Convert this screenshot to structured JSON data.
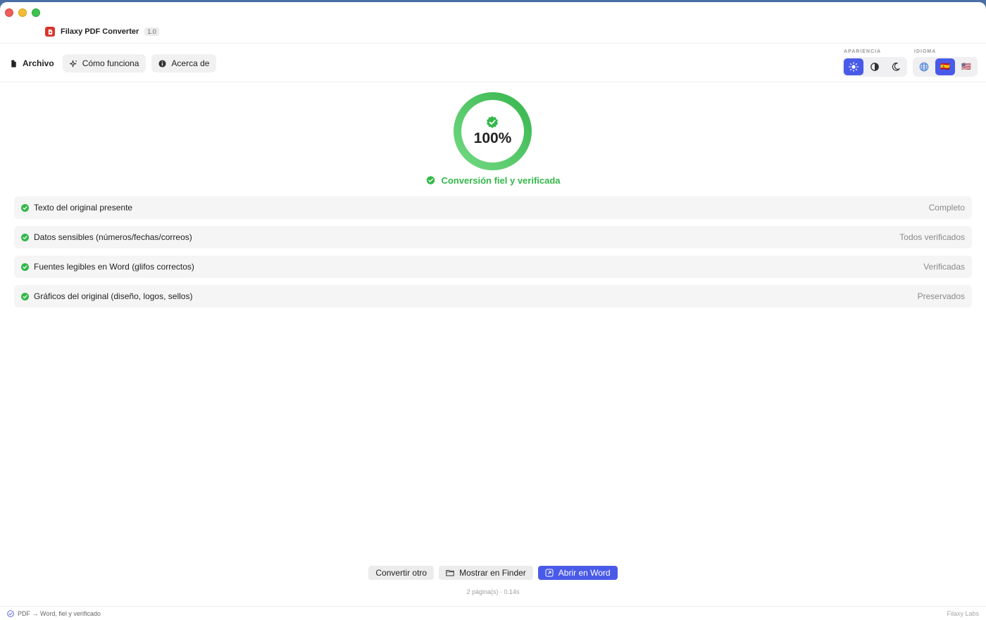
{
  "app": {
    "name": "Filaxy PDF Converter",
    "version": "1.0"
  },
  "nav": {
    "items": [
      {
        "label": "Archivo",
        "icon": "document-icon",
        "active": true
      },
      {
        "label": "Cómo funciona",
        "icon": "sparkle-icon",
        "active": false
      },
      {
        "label": "Acerca de",
        "icon": "info-icon",
        "active": false
      }
    ]
  },
  "appearance": {
    "label": "APARIENCIA",
    "options": [
      {
        "name": "light",
        "icon": "sun-icon",
        "selected": true
      },
      {
        "name": "auto",
        "icon": "contrast-icon",
        "selected": false
      },
      {
        "name": "dark",
        "icon": "moon-icon",
        "selected": false
      }
    ]
  },
  "language": {
    "label": "IDIOMA",
    "options": [
      {
        "name": "auto",
        "icon": "globe-icon",
        "selected": false
      },
      {
        "name": "es",
        "icon": "flag-es-icon",
        "flag": "🇪🇸",
        "selected": true
      },
      {
        "name": "en",
        "icon": "flag-us-icon",
        "flag": "🇺🇸",
        "selected": false
      }
    ]
  },
  "progress": {
    "value": 100,
    "text": "100%"
  },
  "status": {
    "text": "Conversión fiel y verificada"
  },
  "checks": [
    {
      "label": "Texto del original presente",
      "value": "Completo"
    },
    {
      "label": "Datos sensibles (números/fechas/correos)",
      "value": "Todos verificados"
    },
    {
      "label": "Fuentes legibles en Word (glifos correctos)",
      "value": "Verificadas"
    },
    {
      "label": "Gráficos del original (diseño, logos, sellos)",
      "value": "Preservados"
    }
  ],
  "actions": {
    "convert_other": "Convertir otro",
    "show_in_finder": "Mostrar en Finder",
    "open_in_word": "Abrir en Word"
  },
  "meta": "2 página(s) · 0.14s",
  "footer": {
    "left": "PDF → Word, fiel y verificado",
    "right": "Filaxy Labs"
  },
  "colors": {
    "accent": "#4a5ae8",
    "success": "#34b84a",
    "ring_start": "#6dd87d",
    "ring_end": "#3fbf55"
  }
}
